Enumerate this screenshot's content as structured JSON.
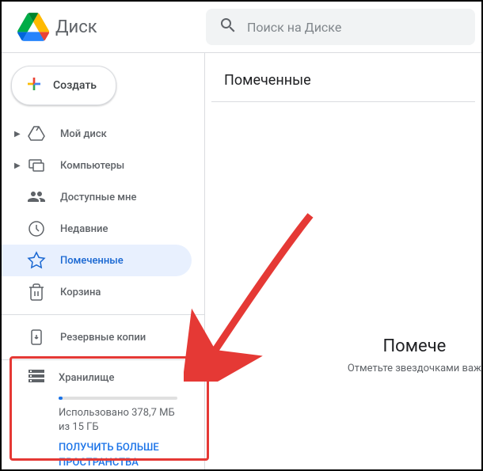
{
  "app": {
    "name": "Диск"
  },
  "search": {
    "placeholder": "Поиск на Диске"
  },
  "create": {
    "label": "Создать"
  },
  "nav": {
    "mydrive": "Мой диск",
    "computers": "Компьютеры",
    "shared": "Доступные мне",
    "recent": "Недавние",
    "starred": "Помеченные",
    "trash": "Корзина",
    "backups": "Резервные копии"
  },
  "storage": {
    "title": "Хранилище",
    "used_text": "Использовано 378,7 МБ из 15 ГБ",
    "upgrade_link": "ПОЛУЧИТЬ БОЛЬШЕ ПРОСТРАНСТВА"
  },
  "main": {
    "title": "Помеченные",
    "empty_title": "Помече",
    "empty_sub": "Отметьте звездочками важ"
  }
}
